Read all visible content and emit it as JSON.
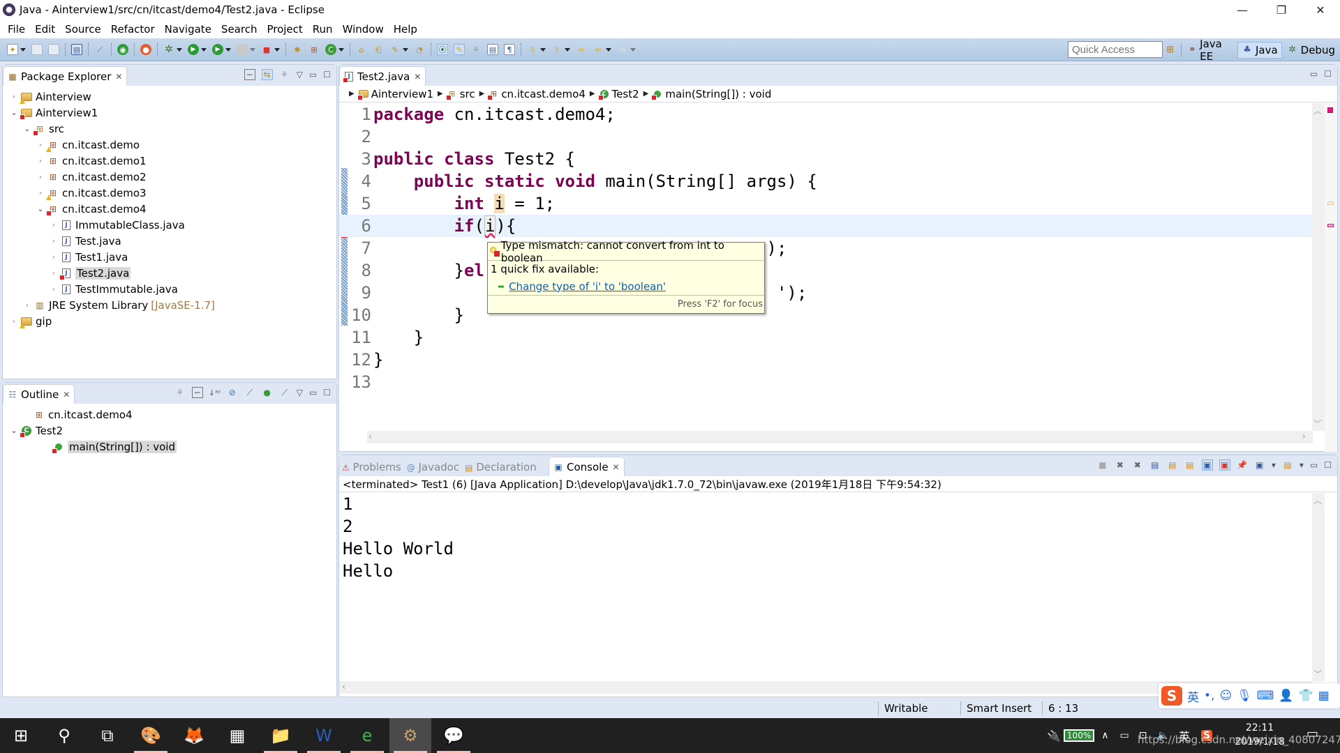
{
  "window": {
    "title": "Java - Ainterview1/src/cn/itcast/demo4/Test2.java - Eclipse",
    "controls": [
      "—",
      "❐",
      "✕"
    ]
  },
  "menu": [
    "File",
    "Edit",
    "Source",
    "Refactor",
    "Navigate",
    "Search",
    "Project",
    "Run",
    "Window",
    "Help"
  ],
  "toolbar": {
    "quick_access_placeholder": "Quick Access",
    "perspectives": [
      {
        "label": "Java EE",
        "active": false
      },
      {
        "label": "Java",
        "active": true
      },
      {
        "label": "Debug",
        "active": false
      }
    ]
  },
  "package_explorer": {
    "title": "Package Explorer",
    "tree": [
      {
        "label": "Ainterview",
        "level": 0,
        "type": "project",
        "expanded": false,
        "overlay": "warning"
      },
      {
        "label": "Ainterview1",
        "level": 0,
        "type": "project",
        "expanded": true,
        "overlay": "error"
      },
      {
        "label": "src",
        "level": 1,
        "type": "source-folder",
        "expanded": true,
        "overlay": "error"
      },
      {
        "label": "cn.itcast.demo",
        "level": 2,
        "type": "package",
        "expanded": false,
        "overlay": "warning"
      },
      {
        "label": "cn.itcast.demo1",
        "level": 2,
        "type": "package",
        "expanded": false,
        "overlay": ""
      },
      {
        "label": "cn.itcast.demo2",
        "level": 2,
        "type": "package",
        "expanded": false,
        "overlay": ""
      },
      {
        "label": "cn.itcast.demo3",
        "level": 2,
        "type": "package",
        "expanded": false,
        "overlay": "warning"
      },
      {
        "label": "cn.itcast.demo4",
        "level": 2,
        "type": "package",
        "expanded": true,
        "overlay": "error"
      },
      {
        "label": "ImmutableClass.java",
        "level": 3,
        "type": "java",
        "expanded": false,
        "overlay": ""
      },
      {
        "label": "Test.java",
        "level": 3,
        "type": "java",
        "expanded": false,
        "overlay": ""
      },
      {
        "label": "Test1.java",
        "level": 3,
        "type": "java",
        "expanded": false,
        "overlay": ""
      },
      {
        "label": "Test2.java",
        "level": 3,
        "type": "java",
        "expanded": false,
        "overlay": "error",
        "selected": true
      },
      {
        "label": "TestImmutable.java",
        "level": 3,
        "type": "java",
        "expanded": false,
        "overlay": ""
      },
      {
        "label": "JRE System Library",
        "decoration": "[JavaSE-1.7]",
        "level": 1,
        "type": "library",
        "expanded": false,
        "overlay": ""
      },
      {
        "label": "gip",
        "level": 0,
        "type": "project",
        "expanded": false,
        "overlay": "warning"
      }
    ]
  },
  "outline": {
    "title": "Outline",
    "tree": [
      {
        "label": "cn.itcast.demo4",
        "level": 0,
        "type": "package",
        "twisty": "none"
      },
      {
        "label": "Test2",
        "level": 0,
        "type": "class",
        "twisty": "open",
        "overlay": "error"
      },
      {
        "label": "main(String[]) : void",
        "level": 1,
        "type": "method",
        "twisty": "none",
        "overlay": "error",
        "selected": true
      }
    ]
  },
  "editor": {
    "tab_label": "Test2.java",
    "breadcrumb": [
      "Ainterview1",
      "src",
      "cn.itcast.demo4",
      "Test2",
      "main(String[]) : void"
    ],
    "current_line": 6,
    "lines": [
      {
        "n": "1",
        "tokens": [
          {
            "t": "package",
            "k": "kw"
          },
          {
            "t": " cn.itcast.demo4;"
          }
        ]
      },
      {
        "n": "2",
        "tokens": []
      },
      {
        "n": "3",
        "tokens": [
          {
            "t": "public",
            "k": "kw"
          },
          {
            "t": " "
          },
          {
            "t": "class",
            "k": "kw"
          },
          {
            "t": " Test2 {"
          }
        ]
      },
      {
        "n": "4",
        "tokens": [
          {
            "t": "    "
          },
          {
            "t": "public",
            "k": "kw"
          },
          {
            "t": " "
          },
          {
            "t": "static",
            "k": "kw"
          },
          {
            "t": " "
          },
          {
            "t": "void",
            "k": "kw"
          },
          {
            "t": " main(String[] args) {"
          }
        ]
      },
      {
        "n": "5",
        "tokens": [
          {
            "t": "        "
          },
          {
            "t": "int",
            "k": "kw"
          },
          {
            "t": " "
          },
          {
            "t": "i",
            "k": "hl-var"
          },
          {
            "t": " = 1;"
          }
        ]
      },
      {
        "n": "6",
        "tokens": [
          {
            "t": "        "
          },
          {
            "t": "if",
            "k": "kw"
          },
          {
            "t": "("
          },
          {
            "t": "i",
            "k": "err-var"
          },
          {
            "t": "){"
          }
        ]
      },
      {
        "n": "7",
        "tokens": [
          {
            "t": "                                       );"
          }
        ]
      },
      {
        "n": "8",
        "tokens": [
          {
            "t": "        }"
          },
          {
            "t": "el",
            "k": "kw"
          }
        ]
      },
      {
        "n": "9",
        "tokens": [
          {
            "t": "                                        ');"
          }
        ]
      },
      {
        "n": "10",
        "tokens": [
          {
            "t": "        }"
          }
        ]
      },
      {
        "n": "11",
        "tokens": [
          {
            "t": "    }"
          }
        ]
      },
      {
        "n": "12",
        "tokens": [
          {
            "t": "}"
          }
        ]
      },
      {
        "n": "13",
        "tokens": []
      }
    ]
  },
  "hover": {
    "message": "Type mismatch: cannot convert from int to boolean",
    "quick_fix_count": "1 quick fix available:",
    "fix_label": "Change type of 'i' to 'boolean'",
    "footer": "Press 'F2' for focus"
  },
  "bottom_views": {
    "tabs": [
      {
        "label": "Problems",
        "active": false
      },
      {
        "label": "Javadoc",
        "active": false
      },
      {
        "label": "Declaration",
        "active": false
      },
      {
        "label": "Console",
        "active": true
      }
    ],
    "console_header": "<terminated> Test1 (6) [Java Application] D:\\develop\\Java\\jdk1.7.0_72\\bin\\javaw.exe (2019年1月18日 下午9:54:32)",
    "console_output": [
      "1",
      "2",
      "Hello World",
      "Hello"
    ]
  },
  "status_bar": {
    "writable": "Writable",
    "insert_mode": "Smart Insert",
    "position": "6 : 13"
  },
  "ime": {
    "lang": "英",
    "punct": "•,"
  },
  "taskbar": {
    "apps": [
      {
        "name": "start",
        "glyph": "⊞"
      },
      {
        "name": "search",
        "glyph": "⚲"
      },
      {
        "name": "task-view",
        "glyph": "⧉"
      },
      {
        "name": "paint",
        "glyph": "🎨",
        "running": true
      },
      {
        "name": "firefox",
        "glyph": "🦊"
      },
      {
        "name": "calculator",
        "glyph": "▦"
      },
      {
        "name": "file-explorer",
        "glyph": "📁",
        "running": true
      },
      {
        "name": "word",
        "glyph": "W",
        "running": true
      },
      {
        "name": "browser",
        "glyph": "e",
        "running": true
      },
      {
        "name": "eclipse",
        "glyph": "⚙",
        "running": true,
        "active": true
      },
      {
        "name": "wechat",
        "glyph": "💬",
        "running": true
      }
    ],
    "battery": "100%",
    "ime_indicator": "英",
    "time": "22:11",
    "date": "2019/1/18",
    "watermark": "https://blog.csdn.net/weixin_40807247"
  }
}
